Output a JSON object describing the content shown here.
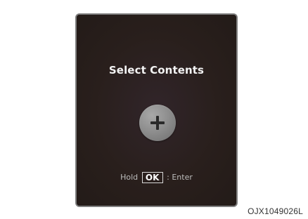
{
  "screen": {
    "title": "Select Contents",
    "add_button": {
      "icon": "plus-icon"
    },
    "hint": {
      "prefix": "Hold",
      "key": "OK",
      "suffix": ": Enter"
    }
  },
  "caption": "OJX1049026L",
  "colors": {
    "screen_background": "#2b211f",
    "frame_border": "#7f7f7f",
    "button_gray": "#8f8f8f",
    "title_text": "#f3f3f3",
    "hint_text": "#bcbcbc"
  }
}
